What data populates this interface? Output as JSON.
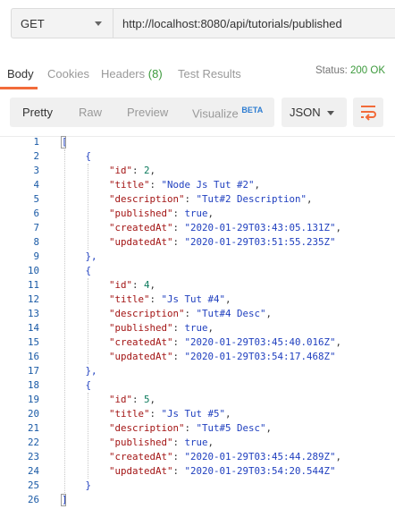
{
  "request": {
    "method": "GET",
    "url": "http://localhost:8080/api/tutorials/published"
  },
  "tabs": {
    "body": "Body",
    "cookies": "Cookies",
    "headers": "Headers",
    "headers_count": "(8)",
    "test_results": "Test Results"
  },
  "status": {
    "label": "Status:",
    "value": "200 OK"
  },
  "toolbar": {
    "views": [
      "Pretty",
      "Raw",
      "Preview",
      "Visualize"
    ],
    "visualize_badge": "BETA",
    "format": "JSON",
    "wrap_icon": "wrap-lines-icon"
  },
  "colors": {
    "accent": "#f26b3a",
    "status_ok": "#3c9a3c",
    "key": "#a31515",
    "string": "#1f3fbf",
    "number": "#0b7a5c"
  },
  "editor": {
    "line_numbers": [
      "1",
      "2",
      "3",
      "4",
      "5",
      "6",
      "7",
      "8",
      "9",
      "10",
      "11",
      "12",
      "13",
      "14",
      "15",
      "16",
      "17",
      "18",
      "19",
      "20",
      "21",
      "22",
      "23",
      "24",
      "25",
      "26"
    ],
    "items": [
      {
        "id": "2",
        "title": "\"Node Js Tut #2\"",
        "description": "\"Tut#2 Description\"",
        "published": "true",
        "createdAt": "\"2020-01-29T03:43:05.131Z\"",
        "updatedAt": "\"2020-01-29T03:51:55.235Z\""
      },
      {
        "id": "4",
        "title": "\"Js Tut #4\"",
        "description": "\"Tut#4 Desc\"",
        "published": "true",
        "createdAt": "\"2020-01-29T03:45:40.016Z\"",
        "updatedAt": "\"2020-01-29T03:54:17.468Z\""
      },
      {
        "id": "5",
        "title": "\"Js Tut #5\"",
        "description": "\"Tut#5 Desc\"",
        "published": "true",
        "createdAt": "\"2020-01-29T03:45:44.289Z\"",
        "updatedAt": "\"2020-01-29T03:54:20.544Z\""
      }
    ],
    "keys": {
      "id": "\"id\"",
      "title": "\"title\"",
      "description": "\"description\"",
      "published": "\"published\"",
      "createdAt": "\"createdAt\"",
      "updatedAt": "\"updatedAt\""
    }
  }
}
